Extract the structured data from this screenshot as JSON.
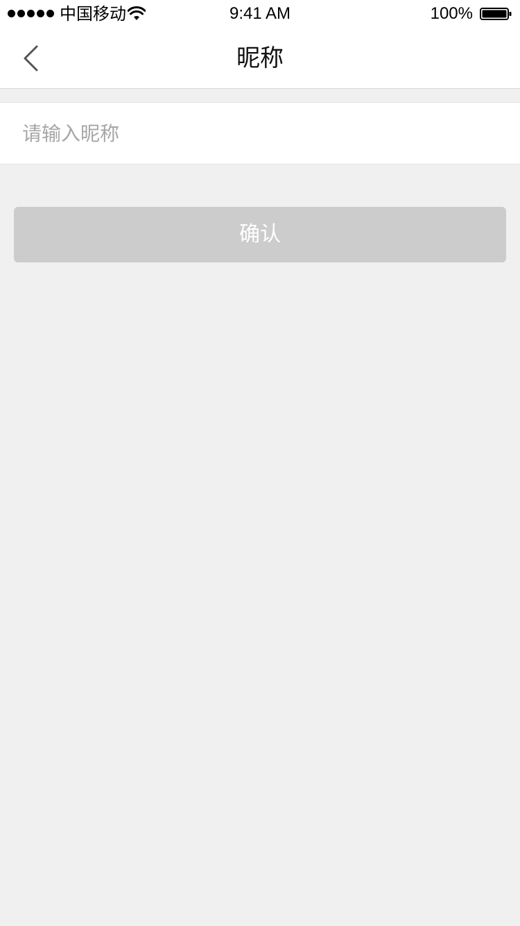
{
  "status_bar": {
    "carrier": "中国移动",
    "time": "9:41 AM",
    "battery_percent": "100%"
  },
  "nav": {
    "back_icon": "chevron-left-icon",
    "title": "昵称"
  },
  "form": {
    "nickname_value": "",
    "nickname_placeholder": "请输入昵称"
  },
  "actions": {
    "confirm_label": "确认",
    "confirm_color": "#cccccc"
  },
  "colors": {
    "background": "#f0f0f0",
    "surface": "#ffffff"
  }
}
